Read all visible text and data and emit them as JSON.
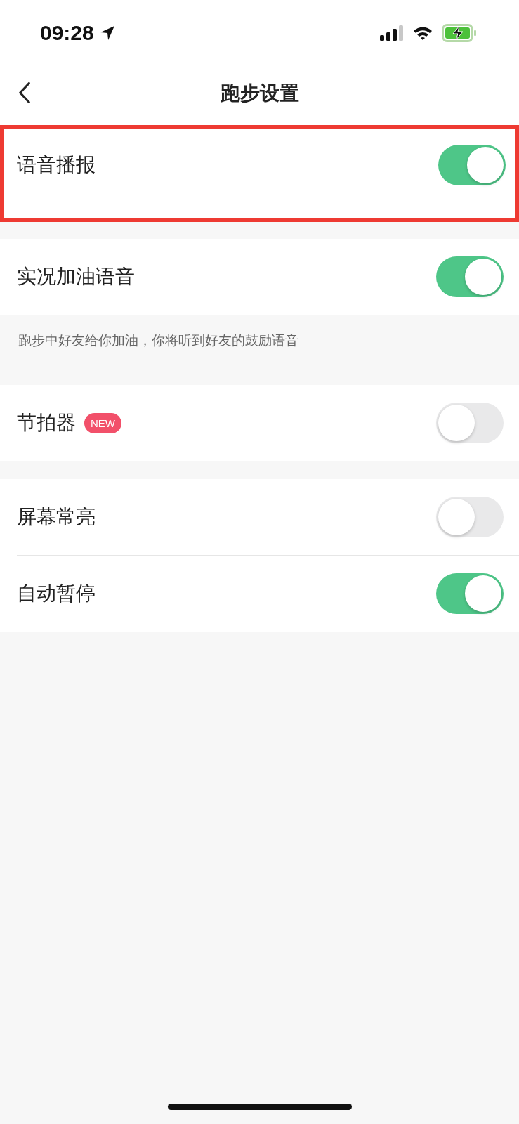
{
  "status_bar": {
    "time": "09:28"
  },
  "nav": {
    "title": "跑步设置"
  },
  "sections": [
    {
      "rows": [
        {
          "label": "语音播报",
          "on": true,
          "highlighted": true
        }
      ]
    },
    {
      "rows": [
        {
          "label": "实况加油语音",
          "on": true,
          "highlighted": false
        }
      ],
      "note": "跑步中好友给你加油，你将听到好友的鼓励语音"
    },
    {
      "rows": [
        {
          "label": "节拍器",
          "badge": "NEW",
          "on": false,
          "highlighted": false
        }
      ]
    },
    {
      "rows": [
        {
          "label": "屏幕常亮",
          "on": false,
          "highlighted": false
        },
        {
          "label": "自动暂停",
          "on": true,
          "highlighted": false
        }
      ]
    }
  ]
}
